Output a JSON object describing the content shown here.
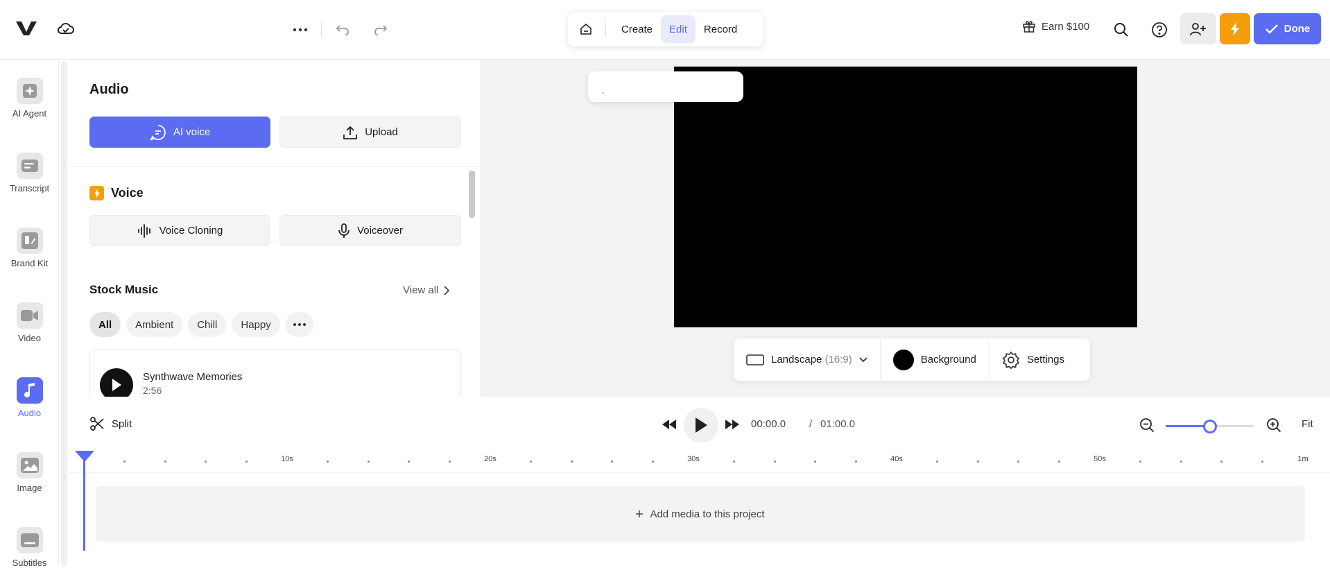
{
  "topbar": {
    "modes": [
      {
        "label": "Create",
        "active": false
      },
      {
        "label": "Edit",
        "active": true
      },
      {
        "label": "Record",
        "active": false
      }
    ],
    "earn_label": "Earn $100",
    "done_label": "Done"
  },
  "sidebar": {
    "items": [
      {
        "label": "AI Agent",
        "icon": "sparkle-icon",
        "active": false
      },
      {
        "label": "Transcript",
        "icon": "transcript-icon",
        "active": false
      },
      {
        "label": "Brand Kit",
        "icon": "brand-kit-icon",
        "active": false
      },
      {
        "label": "Video",
        "icon": "video-camera-icon",
        "active": false
      },
      {
        "label": "Audio",
        "icon": "music-note-icon",
        "active": true
      },
      {
        "label": "Image",
        "icon": "image-icon",
        "active": false
      },
      {
        "label": "Subtitles",
        "icon": "subtitles-icon",
        "active": false
      }
    ]
  },
  "audio_panel": {
    "title": "Audio",
    "ai_voice_label": "AI voice",
    "upload_label": "Upload",
    "voice_section": "Voice",
    "voice_cloning_label": "Voice Cloning",
    "voiceover_label": "Voiceover",
    "stock_music_title": "Stock Music",
    "view_all_label": "View all",
    "chips": [
      "All",
      "Ambient",
      "Chill",
      "Happy"
    ],
    "active_chip": "All",
    "tracks": [
      {
        "name": "Synthwave Memories",
        "duration": "2:56"
      }
    ]
  },
  "canvas": {
    "aspect_label": "Landscape",
    "aspect_ratio": "(16:9)",
    "background_label": "Background",
    "background_color": "#000000",
    "settings_label": "Settings"
  },
  "transport": {
    "split_label": "Split",
    "current_time": "00:00.0",
    "separator": "/",
    "total_time": "01:00.0",
    "fit_label": "Fit",
    "zoom_level": 0.5
  },
  "timeline": {
    "ruler_labels": [
      "10s",
      "20s",
      "30s",
      "40s",
      "50s",
      "1m"
    ],
    "add_media_label": "Add media to this project"
  },
  "colors": {
    "accent": "#5b6cf0",
    "bolt": "#f59e0b"
  }
}
